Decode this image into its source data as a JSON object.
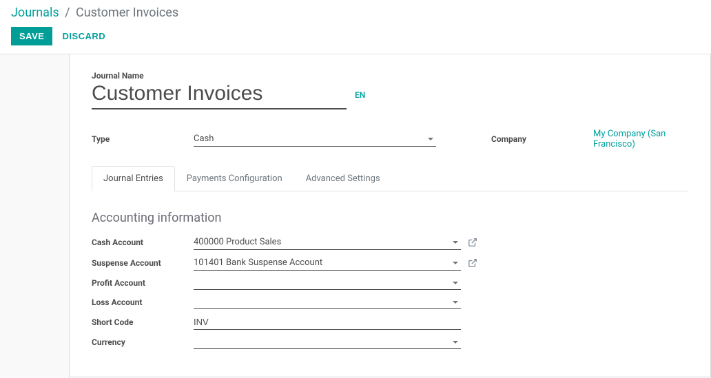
{
  "breadcrumb": {
    "parent": "Journals",
    "current": "Customer Invoices"
  },
  "actions": {
    "save": "SAVE",
    "discard": "DISCARD"
  },
  "header": {
    "name_label": "Journal Name",
    "name_value": "Customer Invoices",
    "lang": "EN"
  },
  "details": {
    "type_label": "Type",
    "type_value": "Cash",
    "company_label": "Company",
    "company_value": "My Company (San Francisco)"
  },
  "tabs": {
    "entries": "Journal Entries",
    "payments": "Payments Configuration",
    "advanced": "Advanced Settings"
  },
  "accounting": {
    "section_title": "Accounting information",
    "cash_account_label": "Cash Account",
    "cash_account_value": "400000 Product Sales",
    "suspense_account_label": "Suspense Account",
    "suspense_account_value": "101401 Bank Suspense Account",
    "profit_account_label": "Profit Account",
    "profit_account_value": "",
    "loss_account_label": "Loss Account",
    "loss_account_value": "",
    "short_code_label": "Short Code",
    "short_code_value": "INV",
    "currency_label": "Currency",
    "currency_value": ""
  }
}
